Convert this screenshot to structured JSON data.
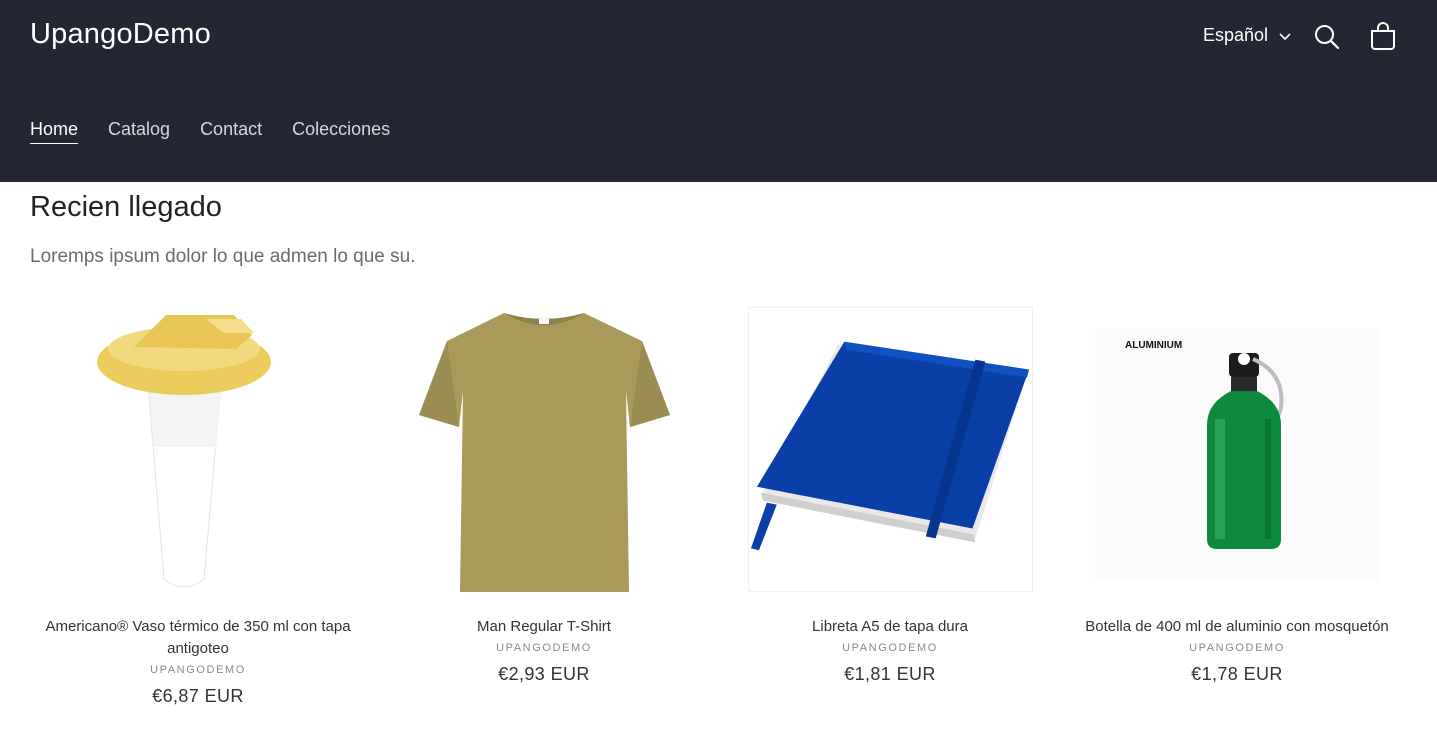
{
  "header": {
    "logo": "UpangoDemo",
    "language": "Español",
    "nav": [
      "Home",
      "Catalog",
      "Contact",
      "Colecciones"
    ]
  },
  "section": {
    "title": "Recien llegado",
    "description": "Loremps ipsum dolor lo que admen lo que su."
  },
  "products": [
    {
      "title": "Americano® Vaso térmico de 350 ml con tapa antigoteo",
      "vendor": "UPANGODEMO",
      "price": "€6,87 EUR",
      "image": "cup-image"
    },
    {
      "title": "Man Regular T-Shirt",
      "vendor": "UPANGODEMO",
      "price": "€2,93 EUR",
      "image": "tshirt-image"
    },
    {
      "title": "Libreta A5 de tapa dura",
      "vendor": "UPANGODEMO",
      "price": "€1,81 EUR",
      "image": "notebook-image"
    },
    {
      "title": "Botella de 400 ml de aluminio con mosquetón",
      "vendor": "UPANGODEMO",
      "price": "€1,78 EUR",
      "image": "bottle-image",
      "image_label": "ALUMINIUM"
    }
  ],
  "colors": {
    "header_bg": "#232733",
    "cup_lid": "#EBCB5C",
    "tshirt": "#A99A5B",
    "notebook": "#0A3FA8",
    "bottle": "#0E8A3E"
  }
}
